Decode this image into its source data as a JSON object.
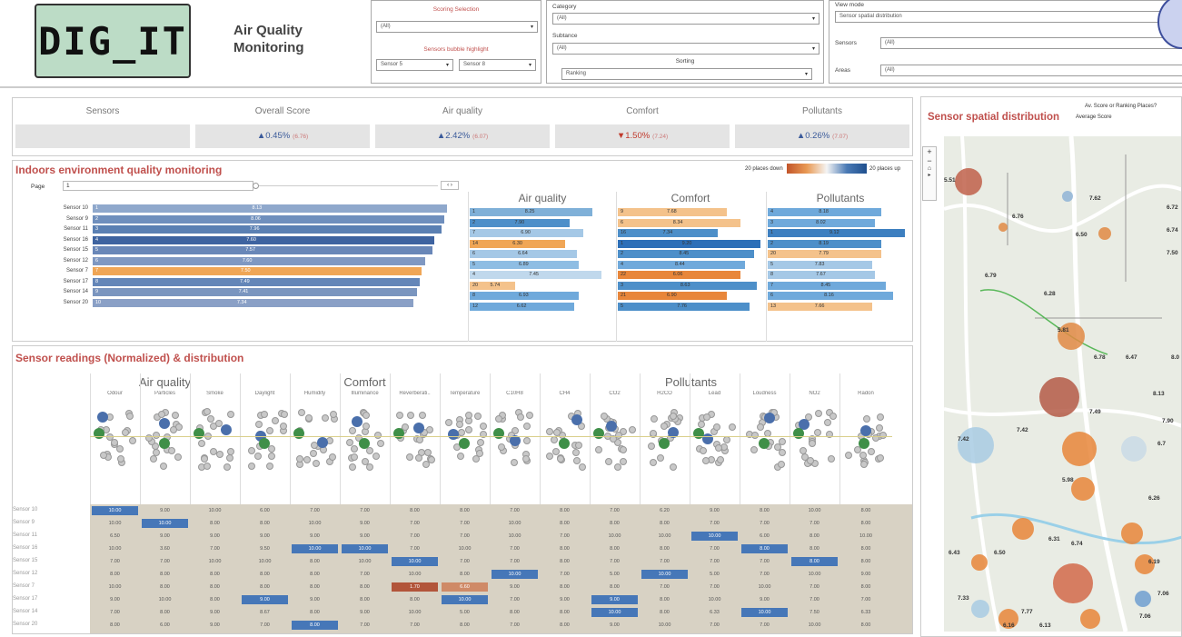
{
  "app": {
    "logo_text": "DIG_IT",
    "title_line1": "Air Quality",
    "title_line2": "Monitoring"
  },
  "filters": {
    "scoring_label": "Scoring Selection",
    "scoring_value": "(All)",
    "bubble_label": "Sensors bubble highlight",
    "bubble_a": "Sensor 5",
    "bubble_b": "Sensor 8",
    "category_label": "Category",
    "category_value": "(All)",
    "substance_label": "Subtance",
    "substance_value": "(All)",
    "sorting_label": "Sorting",
    "sorting_value": "Ranking",
    "viewmode_label": "View mode",
    "viewmode_value": "Sensor spatial distribution",
    "sensors_label": "Sensors",
    "sensors_value": "(All)",
    "areas_label": "Areas",
    "areas_value": "(All)"
  },
  "kpi": [
    {
      "title": "Sensors",
      "value": "",
      "prev": "",
      "dir": "none"
    },
    {
      "title": "Overall Score",
      "value": "0.45%",
      "prev": "(6.76)",
      "dir": "up"
    },
    {
      "title": "Air quality",
      "value": "2.42%",
      "prev": "(6.07)",
      "dir": "up"
    },
    {
      "title": "Comfort",
      "value": "1.50%",
      "prev": "(7.24)",
      "dir": "down"
    },
    {
      "title": "Pollutants",
      "value": "0.26%",
      "prev": "(7.07)",
      "dir": "up"
    }
  ],
  "indoor": {
    "title": "Indoors environment quality monitoring",
    "page_label": "Page",
    "page_value": "1",
    "legend_down": "20 places down",
    "legend_up": "20 places up",
    "sensors": [
      "Sensor 10",
      "Sensor 9",
      "Sensor 11",
      "Sensor 16",
      "Sensor 15",
      "Sensor 12",
      "Sensor 7",
      "Sensor 17",
      "Sensor 14",
      "Sensor 20"
    ],
    "overall_rank": [
      "1",
      "2",
      "3",
      "4",
      "5",
      "6",
      "7",
      "8",
      "9",
      "10"
    ],
    "overall_val": [
      "8.13",
      "8.06",
      "7.96",
      "7.60",
      "7.57",
      "7.60",
      "7.50",
      "7.49",
      "7.41",
      "7.34"
    ],
    "groups": [
      {
        "name": "Air quality",
        "ranks": [
          "1",
          "2",
          "7",
          "14",
          "6",
          "5",
          "4",
          "20",
          "8",
          "12"
        ],
        "vals": [
          "8.25",
          "7.90",
          "6.90",
          "6.30",
          "6.64",
          "6.89",
          "7.45",
          "5.74",
          "6.93",
          "6.62"
        ]
      },
      {
        "name": "Comfort",
        "ranks": [
          "9",
          "6",
          "16",
          "1",
          "2",
          "4",
          "22",
          "3",
          "21",
          "5"
        ],
        "vals": [
          "7.68",
          "8.34",
          "7.34",
          "9.20",
          "8.45",
          "8.44",
          "6.06",
          "8.63",
          "6.90",
          "7.76"
        ]
      },
      {
        "name": "Pollutants",
        "ranks": [
          "4",
          "3",
          "1",
          "2",
          "20",
          "5",
          "8",
          "7",
          "6",
          "13"
        ],
        "vals": [
          "8.18",
          "8.02",
          "9.12",
          "8.19",
          "7.79",
          "7.83",
          "7.67",
          "8.45",
          "8.16",
          "7.66"
        ]
      }
    ]
  },
  "readings": {
    "title": "Sensor readings (Normalized) & distribution",
    "categories": [
      "Air quality",
      "Comfort",
      "Pollutants"
    ],
    "columns": [
      "Odour",
      "Particles",
      "Smoke",
      "Daylight",
      "Humidity",
      "Illuminance",
      "Reverberati..",
      "Temperature",
      "C10H8",
      "CH4",
      "CO2",
      "H2CO",
      "Lead",
      "Loudness",
      "NO2",
      "Radon"
    ],
    "sensors": [
      "Sensor 10",
      "Sensor 9",
      "Sensor 11",
      "Sensor 16",
      "Sensor 15",
      "Sensor 12",
      "Sensor 7",
      "Sensor 17",
      "Sensor 14",
      "Sensor 20"
    ],
    "rows": [
      [
        "10.00",
        "9.00",
        "10.00",
        "6.00",
        "7.00",
        "7.00",
        "8.00",
        "8.00",
        "7.00",
        "8.00",
        "7.00",
        "6.20",
        "9.00",
        "8.00",
        "10.00",
        "8.00"
      ],
      [
        "10.00",
        "10.00",
        "8.00",
        "8.00",
        "10.00",
        "9.00",
        "7.00",
        "7.00",
        "10.00",
        "8.00",
        "8.00",
        "8.00",
        "7.00",
        "7.00",
        "7.00",
        "8.00"
      ],
      [
        "6.50",
        "9.00",
        "9.00",
        "9.00",
        "9.00",
        "9.00",
        "7.00",
        "7.00",
        "10.00",
        "7.00",
        "10.00",
        "10.00",
        "10.00",
        "6.00",
        "8.00",
        "10.00"
      ],
      [
        "10.00",
        "3.60",
        "7.00",
        "9.50",
        "10.00",
        "10.00",
        "7.00",
        "10.00",
        "7.00",
        "8.00",
        "8.00",
        "8.00",
        "7.00",
        "8.00",
        "8.00",
        "8.00"
      ],
      [
        "7.00",
        "7.00",
        "10.00",
        "10.00",
        "8.00",
        "10.00",
        "10.00",
        "7.00",
        "7.00",
        "8.00",
        "7.00",
        "7.00",
        "7.00",
        "7.00",
        "8.00",
        "8.00"
      ],
      [
        "8.00",
        "8.00",
        "8.00",
        "8.00",
        "8.00",
        "7.00",
        "10.00",
        "8.00",
        "10.00",
        "7.00",
        "5.00",
        "10.00",
        "5.00",
        "7.00",
        "10.00",
        "9.00"
      ],
      [
        "10.00",
        "8.00",
        "8.00",
        "8.00",
        "8.00",
        "8.00",
        "1.70",
        "6.60",
        "9.00",
        "8.00",
        "8.00",
        "7.00",
        "7.00",
        "10.00",
        "7.00",
        "8.00"
      ],
      [
        "9.00",
        "10.00",
        "8.00",
        "9.00",
        "9.00",
        "8.00",
        "8.00",
        "10.00",
        "7.00",
        "9.00",
        "9.00",
        "8.00",
        "10.00",
        "9.00",
        "7.00",
        "7.00"
      ],
      [
        "7.00",
        "8.00",
        "9.00",
        "8.67",
        "8.00",
        "9.00",
        "10.00",
        "5.00",
        "8.00",
        "8.00",
        "10.00",
        "8.00",
        "6.33",
        "10.00",
        "7.50",
        "6.33"
      ],
      [
        "8.00",
        "6.00",
        "9.00",
        "7.00",
        "8.00",
        "7.00",
        "7.00",
        "8.00",
        "7.00",
        "8.00",
        "9.00",
        "10.00",
        "7.00",
        "7.00",
        "10.00",
        "8.00"
      ]
    ],
    "highlights": [
      [
        0,
        0,
        "b"
      ],
      [
        1,
        1,
        "b"
      ],
      [
        2,
        12,
        "b"
      ],
      [
        3,
        4,
        "b"
      ],
      [
        3,
        5,
        "b"
      ],
      [
        3,
        13,
        "b"
      ],
      [
        4,
        6,
        "b"
      ],
      [
        4,
        14,
        "b"
      ],
      [
        5,
        8,
        "b"
      ],
      [
        5,
        11,
        "b"
      ],
      [
        6,
        6,
        "o"
      ],
      [
        6,
        7,
        "h"
      ],
      [
        7,
        3,
        "b"
      ],
      [
        7,
        7,
        "b"
      ],
      [
        7,
        10,
        "b"
      ],
      [
        8,
        10,
        "b"
      ],
      [
        8,
        13,
        "b"
      ],
      [
        9,
        4,
        "b"
      ]
    ]
  },
  "map": {
    "title": "Sensor spatial distribution",
    "toggle_label": "Av. Score or Ranking Places?",
    "toggle_value": "Average Score",
    "labels": [
      "5.51",
      "6.76",
      "7.62",
      "6.72",
      "6.74",
      "6.50",
      "7.50",
      "6.79",
      "6.28",
      "5.81",
      "6.78",
      "6.47",
      "8.0",
      "8.13",
      "7.42",
      "7.42",
      "7.49",
      "7.90",
      "6.7",
      "5.98",
      "6.26",
      "6.43",
      "6.50",
      "6.31",
      "6.74",
      "6.19",
      "7.33",
      "7.06",
      "7.06",
      "7.77",
      "6.16",
      "6.13"
    ]
  }
}
